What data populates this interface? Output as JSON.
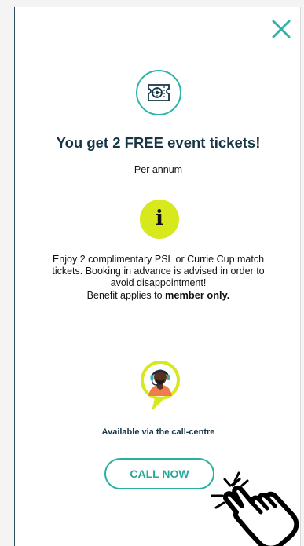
{
  "modal": {
    "title": "You get 2 FREE event tickets!",
    "subtitle": "Per annum",
    "info_icon_letter": "i",
    "description_line_1": "Enjoy 2 complimentary PSL or Currie Cup match",
    "description_line_2": "tickets. Booking in advance is advised in order to",
    "description_line_3": "avoid disappointment!",
    "benefit_prefix": "Benefit applies to ",
    "benefit_emphasis": "member only.",
    "availability": "Available via the call-centre",
    "call_button_label": "CALL NOW"
  },
  "icons": {
    "close": "close-icon",
    "ticket": "ticket-icon",
    "info": "info-icon",
    "agent": "call-centre-agent-icon",
    "cursor": "hand-pointer-icon"
  },
  "colors": {
    "teal": "#2eb4a8",
    "navy_text": "#163646",
    "lime": "#d7e81c",
    "orange": "#ef7d4a"
  }
}
